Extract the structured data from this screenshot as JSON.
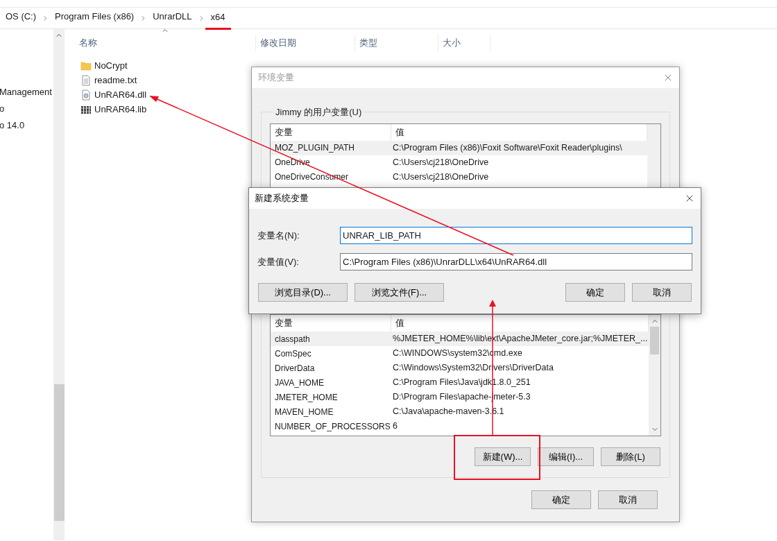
{
  "explorer": {
    "breadcrumb": [
      {
        "label": "OS (C:)",
        "underlined": false
      },
      {
        "label": "Program Files (x86)",
        "underlined": false
      },
      {
        "label": "UnrarDLL",
        "underlined": false
      },
      {
        "label": "x64",
        "underlined": true
      }
    ],
    "nav_items": [
      "Management",
      "o",
      "o 14.0"
    ],
    "columns": [
      "名称",
      "修改日期",
      "类型",
      "大小"
    ],
    "files": [
      {
        "name": "NoCrypt",
        "kind": "folder"
      },
      {
        "name": "readme.txt",
        "kind": "text"
      },
      {
        "name": "UnRAR64.dll",
        "kind": "dll"
      },
      {
        "name": "UnRAR64.lib",
        "kind": "lib"
      }
    ]
  },
  "env_dialog": {
    "title": "环境变量",
    "active": false,
    "user_group": {
      "label": "Jimmy 的用户变量(U)",
      "columns": [
        "变量",
        "值"
      ],
      "rows": [
        {
          "name": "MOZ_PLUGIN_PATH",
          "value": "C:\\Program Files (x86)\\Foxit Software\\Foxit Reader\\plugins\\",
          "selected": true
        },
        {
          "name": "OneDrive",
          "value": "C:\\Users\\cj218\\OneDrive",
          "selected": false
        },
        {
          "name": "OneDriveConsumer",
          "value": "C:\\Users\\cj218\\OneDrive",
          "selected": false
        }
      ]
    },
    "system_group": {
      "columns": [
        "变量",
        "值"
      ],
      "rows": [
        {
          "name": "classpath",
          "value": "%JMETER_HOME%\\lib\\ext\\ApacheJMeter_core.jar;%JMETER_...",
          "selected": true
        },
        {
          "name": "ComSpec",
          "value": "C:\\WINDOWS\\system32\\cmd.exe",
          "selected": false
        },
        {
          "name": "DriverData",
          "value": "C:\\Windows\\System32\\Drivers\\DriverData",
          "selected": false
        },
        {
          "name": "JAVA_HOME",
          "value": "C:\\Program Files\\Java\\jdk1.8.0_251",
          "selected": false
        },
        {
          "name": "JMETER_HOME",
          "value": "D:\\Program Files\\apache-jmeter-5.3",
          "selected": false
        },
        {
          "name": "MAVEN_HOME",
          "value": "C:\\Java\\apache-maven-3.6.1",
          "selected": false
        },
        {
          "name": "NUMBER_OF_PROCESSORS",
          "value": "6",
          "selected": false
        }
      ],
      "buttons": [
        "新建(W)...",
        "编辑(I)...",
        "删除(L)"
      ]
    },
    "buttons": [
      "确定",
      "取消"
    ]
  },
  "new_dialog": {
    "title": "新建系统变量",
    "active": true,
    "fields": [
      {
        "label": "变量名(N):",
        "value": "UNRAR_LIB_PATH",
        "focused": true
      },
      {
        "label": "变量值(V):",
        "value": "C:\\Program Files (x86)\\UnrarDLL\\x64\\UnRAR64.dll",
        "focused": false
      }
    ],
    "left_buttons": [
      "浏览目录(D)...",
      "浏览文件(F)..."
    ],
    "right_buttons": [
      "确定",
      "取消"
    ]
  }
}
